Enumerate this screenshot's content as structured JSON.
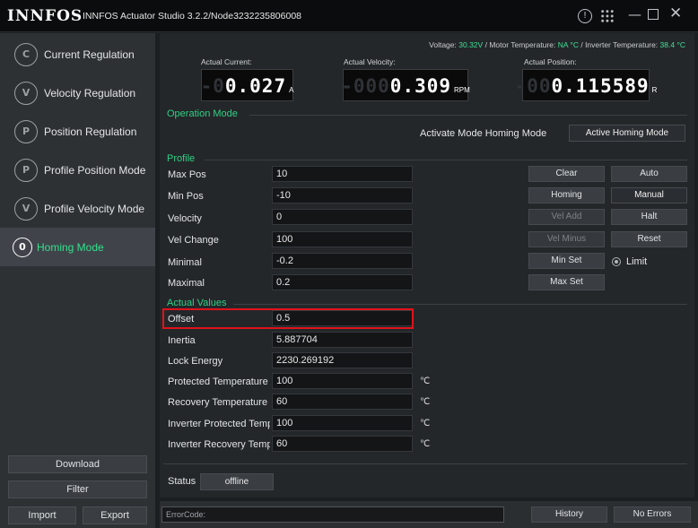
{
  "titlebar": {
    "logo": "INNFOS",
    "title": "INNFOS Actuator Studio 3.2.2/Node3232235806008",
    "info_glyph": "!",
    "minimize_glyph": "—",
    "close_glyph": "✕"
  },
  "sidebar": {
    "items": [
      {
        "label": "Current Regulation",
        "icon": "current-regulation-icon",
        "glyph": "C"
      },
      {
        "label": "Velocity Regulation",
        "icon": "velocity-regulation-icon",
        "glyph": "V"
      },
      {
        "label": "Position Regulation",
        "icon": "position-regulation-icon",
        "glyph": "P"
      },
      {
        "label": "Profile Position Mode",
        "icon": "profile-position-icon",
        "glyph": "P"
      },
      {
        "label": "Profile Velocity Mode",
        "icon": "profile-velocity-icon",
        "glyph": "V"
      },
      {
        "label": "Homing Mode",
        "icon": "homing-mode-icon",
        "glyph": "0"
      }
    ],
    "download": "Download",
    "filter": "Filter",
    "import": "Import",
    "export": "Export"
  },
  "status_line": {
    "voltage_label": "Voltage:",
    "voltage": "30.32V",
    "motor_label": "/ Motor Temperature:",
    "motor_temp": "NA °C",
    "inverter_label": "/ Inverter Temperature:",
    "inverter_temp": "38.4 °C"
  },
  "meters": {
    "current": {
      "label": "Actual Current:",
      "dim": "-0",
      "value": "0.027",
      "unit": "A"
    },
    "velocity": {
      "label": "Actual Velocity:",
      "dim": "-000",
      "value": "0.309",
      "unit": "RPM"
    },
    "position": {
      "label": "Actual Position:",
      "dim": "-00",
      "value": "0.115589",
      "unit": "R"
    }
  },
  "operation_mode": {
    "title": "Operation Mode",
    "activate_text": "Activate Mode Homing Mode",
    "active_button": "Active Homing Mode"
  },
  "profile": {
    "title": "Profile",
    "rows": [
      {
        "label": "Max Pos",
        "value": "10"
      },
      {
        "label": "Min Pos",
        "value": "-10"
      },
      {
        "label": "Velocity",
        "value": "0"
      },
      {
        "label": "Vel Change",
        "value": "100"
      },
      {
        "label": "Minimal",
        "value": "-0.2"
      },
      {
        "label": "Maximal",
        "value": "0.2"
      }
    ]
  },
  "actual_values": {
    "title": "Actual Values",
    "rows": [
      {
        "label": "Offset",
        "value": "0.5"
      },
      {
        "label": "Inertia",
        "value": "5.887704"
      },
      {
        "label": "Lock Energy",
        "value": "2230.269192"
      },
      {
        "label": "Protected Temperature",
        "value": "100",
        "unit": "℃"
      },
      {
        "label": "Recovery Temperature",
        "value": "60",
        "unit": "℃"
      },
      {
        "label": "Inverter Protected Temperature",
        "value": "100",
        "unit": "℃"
      },
      {
        "label": "Inverter Recovery Temperature",
        "value": "60",
        "unit": "℃"
      }
    ]
  },
  "buttons": {
    "clear": "Clear",
    "auto": "Auto",
    "homing": "Homing",
    "manual": "Manual",
    "vel_add": "Vel Add",
    "halt": "Halt",
    "vel_minus": "Vel Minus",
    "reset": "Reset",
    "min_set": "Min Set",
    "limit": "Limit",
    "max_set": "Max Set"
  },
  "status": {
    "label": "Status",
    "value": "offline"
  },
  "bottom": {
    "error_code": "ErrorCode:",
    "history": "History",
    "no_errors": "No Errors"
  },
  "colors": {
    "accent_green": "#2fd084",
    "highlight_red": "#e0131b"
  }
}
